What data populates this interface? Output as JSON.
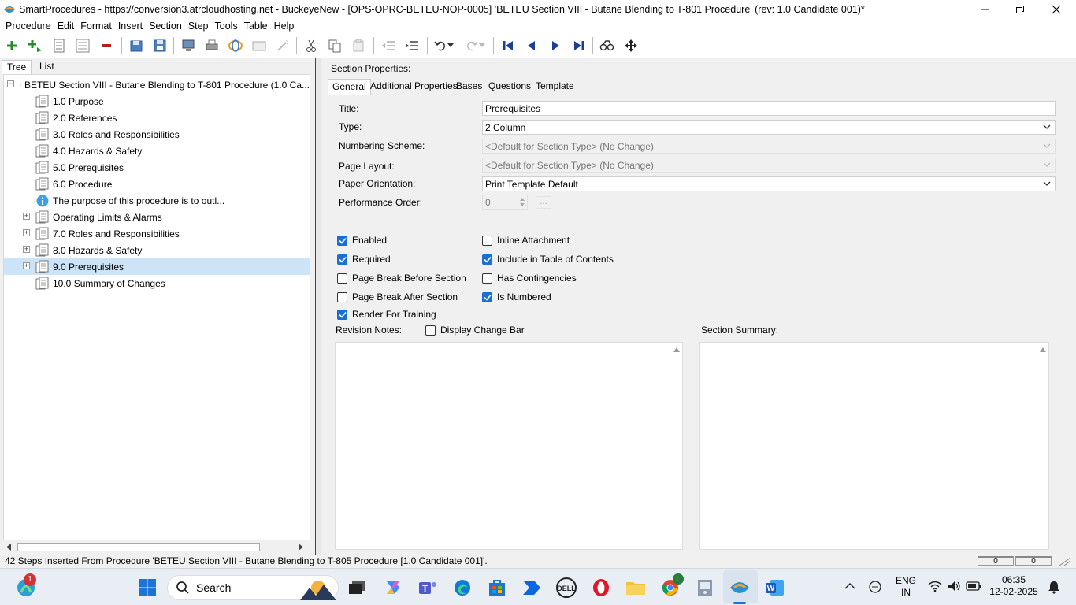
{
  "window": {
    "title": "SmartProcedures - https://conversion3.atrcloudhosting.net - BuckeyeNew - [OPS-OPRC-BETEU-NOP-0005] 'BETEU Section VIII - Butane Blending to T-801 Procedure' (rev: 1.0 Candidate 001)*"
  },
  "menu": {
    "items": [
      "Procedure",
      "Edit",
      "Format",
      "Insert",
      "Section",
      "Step",
      "Tools",
      "Table",
      "Help"
    ]
  },
  "left_panel": {
    "tabs": [
      "Tree",
      "List"
    ],
    "root": "BETEU Section VIII - Butane Blending to T-801 Procedure (1.0 Ca...",
    "items": [
      {
        "label": "1.0 Purpose",
        "type": "doc"
      },
      {
        "label": "2.0 References",
        "type": "doc"
      },
      {
        "label": "3.0 Roles and Responsibilities",
        "type": "doc"
      },
      {
        "label": "4.0 Hazards & Safety",
        "type": "doc"
      },
      {
        "label": "5.0 Prerequisites",
        "type": "doc"
      },
      {
        "label": "6.0 Procedure",
        "type": "doc"
      },
      {
        "label": "The purpose of this procedure is to outl...",
        "type": "info"
      },
      {
        "label": "Operating Limits & Alarms",
        "type": "doc-expandable"
      },
      {
        "label": "7.0 Roles and Responsibilities",
        "type": "doc-expandable"
      },
      {
        "label": "8.0 Hazards & Safety",
        "type": "doc-expandable"
      },
      {
        "label": "9.0 Prerequisites",
        "type": "doc-expandable",
        "selected": true
      },
      {
        "label": "10.0 Summary of Changes",
        "type": "doc"
      }
    ]
  },
  "right_panel": {
    "header": "Section Properties:",
    "tabs": [
      "General",
      "Additional Properties",
      "Bases",
      "Questions",
      "Template"
    ],
    "fields": {
      "title_label": "Title:",
      "title_value": "Prerequisites",
      "type_label": "Type:",
      "type_value": "2 Column",
      "numbering_label": "Numbering Scheme:",
      "numbering_value": "<Default for Section Type> (No Change)",
      "page_layout_label": "Page Layout:",
      "page_layout_value": "<Default for Section Type> (No Change)",
      "orientation_label": "Paper Orientation:",
      "orientation_value": "Print Template Default",
      "perf_order_label": "Performance Order:",
      "perf_order_value": "0",
      "ellipsis": "..."
    },
    "checkboxes": {
      "enabled": {
        "label": "Enabled",
        "checked": true
      },
      "required": {
        "label": "Required",
        "checked": true
      },
      "page_break_before": {
        "label": "Page Break Before Section",
        "checked": false
      },
      "page_break_after": {
        "label": "Page Break After Section",
        "checked": false
      },
      "render_training": {
        "label": "Render For Training",
        "checked": true
      },
      "inline_attachment": {
        "label": "Inline Attachment",
        "checked": false
      },
      "include_toc": {
        "label": "Include in Table of Contents",
        "checked": true
      },
      "has_contingencies": {
        "label": "Has Contingencies",
        "checked": false
      },
      "is_numbered": {
        "label": "Is Numbered",
        "checked": true
      },
      "display_change_bar": {
        "label": "Display Change Bar",
        "checked": false
      }
    },
    "revision_notes_label": "Revision Notes:",
    "section_summary_label": "Section Summary:"
  },
  "status": {
    "message": "42 Steps Inserted From Procedure 'BETEU Section VIII - Butane Blending to T-805 Procedure [1.0 Candidate 001]'.",
    "box1": "0",
    "box2": "0"
  },
  "taskbar": {
    "search_placeholder": "Search",
    "notification_badge": "1",
    "chrome_badge": "L",
    "lang_line1": "ENG",
    "lang_line2": "IN",
    "time": "06:35",
    "date": "12-02-2025"
  },
  "colors": {
    "selection": "#cce4f7",
    "checkbox_checked": "#1a6fd6",
    "nav_blue": "#1c3f94"
  }
}
